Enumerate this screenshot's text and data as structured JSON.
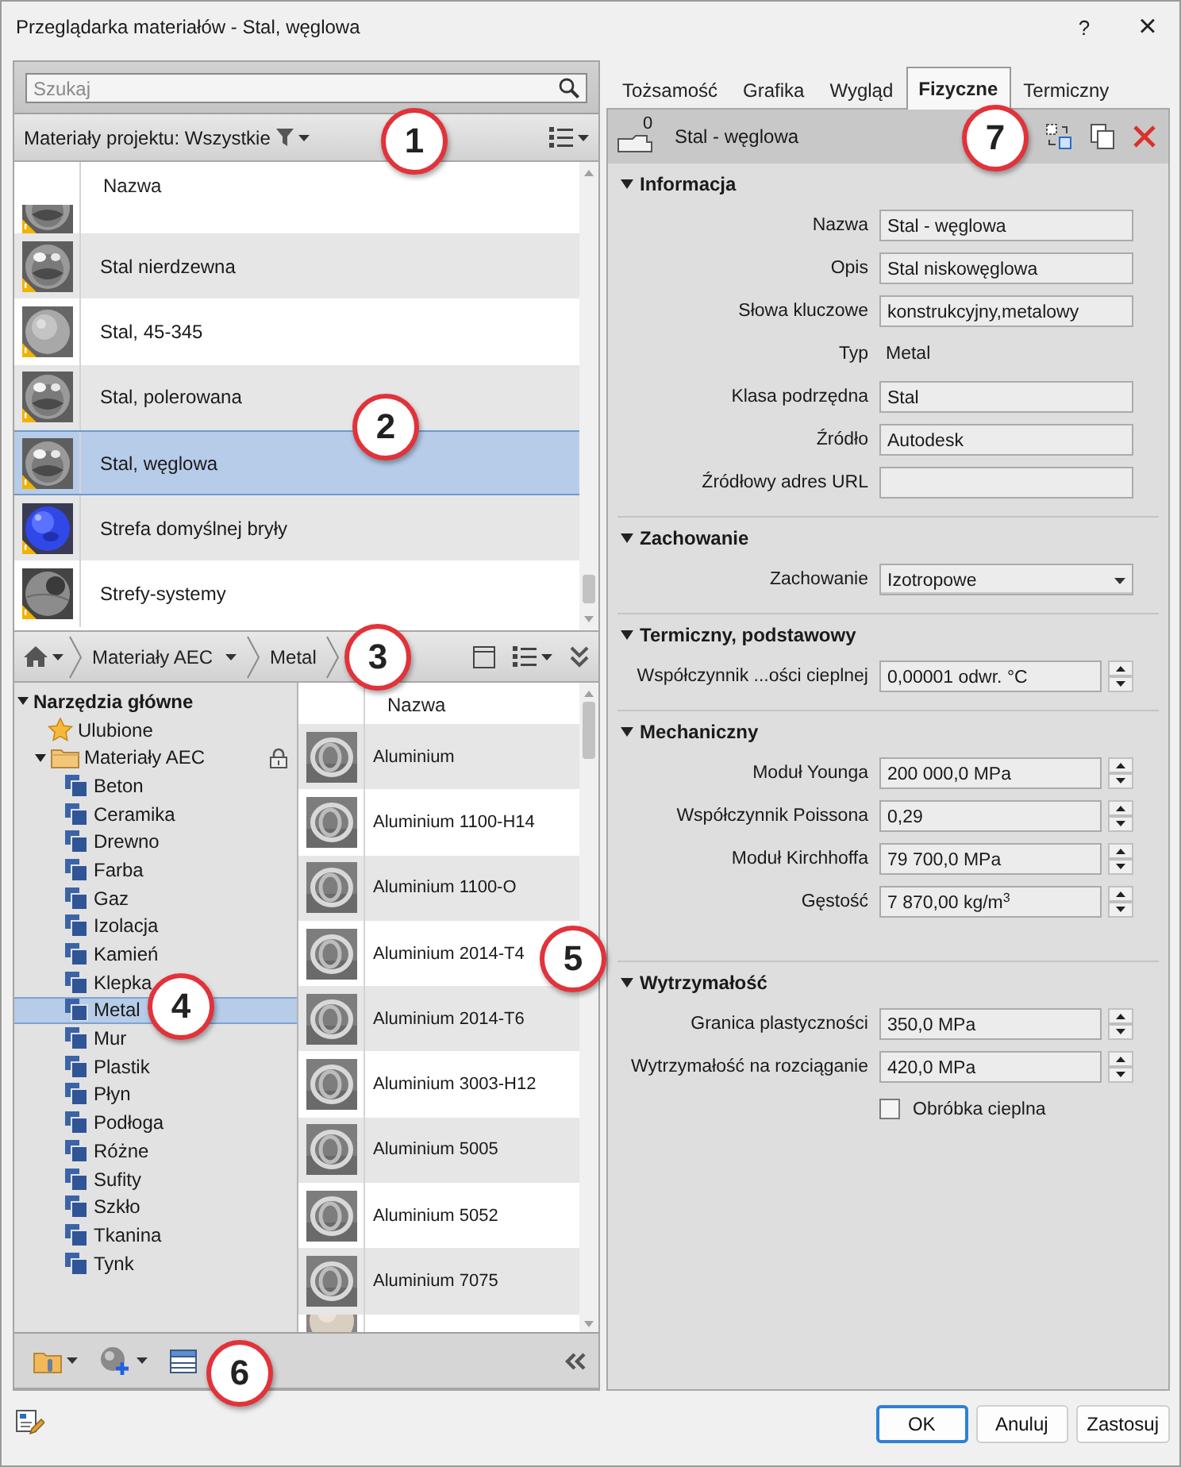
{
  "window": {
    "title": "Przeglądarka materiałów - Stal, węglowa",
    "help": "?",
    "close": "×"
  },
  "search": {
    "placeholder": "Szukaj"
  },
  "project_filter": {
    "label": "Materiały projektu: Wszystkie"
  },
  "project_materials": {
    "column": "Nazwa",
    "rows": [
      {
        "kind": "steel",
        "warning": true,
        "selected": false
      },
      {
        "name": "Stal nierdzewna",
        "kind": "steel",
        "warning": true,
        "selected": false
      },
      {
        "name": "Stal, 45-345",
        "kind": "matte",
        "warning": true,
        "selected": false
      },
      {
        "name": "Stal, polerowana",
        "kind": "steel",
        "warning": true,
        "selected": false
      },
      {
        "name": "Stal, węglowa",
        "kind": "steel",
        "warning": true,
        "selected": true
      },
      {
        "name": "Strefa domyślnej bryły",
        "kind": "blue",
        "warning": true,
        "selected": false
      },
      {
        "name": "Strefy-systemy",
        "kind": "dark",
        "warning": true,
        "selected": false
      }
    ]
  },
  "breadcrumb": [
    {
      "label": "Materiały AEC",
      "dropdown": true
    },
    {
      "label": "Metal",
      "dropdown": false
    }
  ],
  "tree": {
    "label": "Narzędzia główne",
    "expanded": true,
    "selected": false,
    "children": [
      {
        "label": "Ulubione",
        "kind": "favorites",
        "selected": false
      },
      {
        "label": "Materiały AEC",
        "kind": "folder",
        "expanded": true,
        "locked": true,
        "selected": false,
        "children": [
          {
            "label": "Beton",
            "kind": "category",
            "selected": false
          },
          {
            "label": "Ceramika",
            "kind": "category",
            "selected": false
          },
          {
            "label": "Drewno",
            "kind": "category",
            "selected": false
          },
          {
            "label": "Farba",
            "kind": "category",
            "selected": false
          },
          {
            "label": "Gaz",
            "kind": "category",
            "selected": false
          },
          {
            "label": "Izolacja",
            "kind": "category",
            "selected": false
          },
          {
            "label": "Kamień",
            "kind": "category",
            "selected": false
          },
          {
            "label": "Klepka",
            "kind": "category",
            "selected": false
          },
          {
            "label": "Metal",
            "kind": "category",
            "selected": true
          },
          {
            "label": "Mur",
            "kind": "category",
            "selected": false
          },
          {
            "label": "Plastik",
            "kind": "category",
            "selected": false
          },
          {
            "label": "Płyn",
            "kind": "category",
            "selected": false
          },
          {
            "label": "Podłoga",
            "kind": "category",
            "selected": false
          },
          {
            "label": "Różne",
            "kind": "category",
            "selected": false
          },
          {
            "label": "Sufity",
            "kind": "category",
            "selected": false
          },
          {
            "label": "Szkło",
            "kind": "category",
            "selected": false
          },
          {
            "label": "Tkanina",
            "kind": "category",
            "selected": false
          },
          {
            "label": "Tynk",
            "kind": "category",
            "selected": false
          }
        ]
      }
    ]
  },
  "library_materials": {
    "column": "Nazwa",
    "rows": [
      {
        "name": "Aluminium",
        "kind": "ring",
        "selected": false
      },
      {
        "name": "Aluminium 1100-H14",
        "kind": "ring",
        "selected": false
      },
      {
        "name": "Aluminium 1100-O",
        "kind": "ring",
        "selected": false
      },
      {
        "name": "Aluminium 2014-T4",
        "kind": "ring",
        "selected": false
      },
      {
        "name": "Aluminium 2014-T6",
        "kind": "ring",
        "selected": false
      },
      {
        "name": "Aluminium 3003-H12",
        "kind": "ring",
        "selected": false
      },
      {
        "name": "Aluminium 5005",
        "kind": "ring",
        "selected": false
      },
      {
        "name": "Aluminium 5052",
        "kind": "ring",
        "selected": false
      },
      {
        "name": "Aluminium 7075",
        "kind": "ring",
        "selected": false
      },
      {
        "kind": "beige",
        "selected": false
      }
    ]
  },
  "tabs": [
    {
      "label": "Tożsamość",
      "selected": false
    },
    {
      "label": "Grafika",
      "selected": false
    },
    {
      "label": "Wygląd",
      "selected": false
    },
    {
      "label": "Fizyczne",
      "selected": true
    },
    {
      "label": "Termiczny",
      "selected": false
    }
  ],
  "asset": {
    "count": "0",
    "name": "Stal - węglowa"
  },
  "sections": [
    {
      "title": "Informacja",
      "expanded": true,
      "properties": [
        {
          "label": "Nazwa",
          "kind": "text",
          "value": "Stal - węglowa"
        },
        {
          "label": "Opis",
          "kind": "text",
          "value": "Stal niskowęglowa"
        },
        {
          "label": "Słowa kluczowe",
          "kind": "text",
          "value": "konstrukcyjny,metalowy"
        },
        {
          "label": "Typ",
          "kind": "static",
          "value": "Metal"
        },
        {
          "label": "Klasa podrzędna",
          "kind": "text",
          "value": "Stal"
        },
        {
          "label": "Źródło",
          "kind": "text",
          "value": "Autodesk"
        },
        {
          "label": "Źródłowy adres URL",
          "kind": "text"
        }
      ]
    },
    {
      "title": "Zachowanie",
      "expanded": true,
      "properties": [
        {
          "label": "Zachowanie",
          "kind": "dropdown",
          "value": "Izotropowe"
        }
      ]
    },
    {
      "title": "Termiczny, podstawowy",
      "expanded": true,
      "properties": [
        {
          "label": "Współczynnik ...ości cieplnej",
          "kind": "spinner",
          "value": "0,00001 odwr. °C"
        }
      ]
    },
    {
      "title": "Mechaniczny",
      "expanded": true,
      "properties": [
        {
          "label": "Moduł Younga",
          "kind": "spinner",
          "value": "200 000,0 MPa"
        },
        {
          "label": "Współczynnik Poissona",
          "kind": "spinner",
          "value": "0,29"
        },
        {
          "label": "Moduł Kirchhoffa",
          "kind": "spinner",
          "value": "79 700,0 MPa"
        },
        {
          "label": "Gęstość",
          "kind": "spinner",
          "value": "7 870,00 kg/m$^{3}$"
        }
      ]
    },
    {
      "title": "Wytrzymałość",
      "expanded": true,
      "properties": [
        {
          "label": "Granica plastyczności",
          "kind": "spinner",
          "value": "350,0 MPa"
        },
        {
          "label": "Wytrzymałość na rozciąganie",
          "kind": "spinner",
          "value": "420,0 MPa"
        },
        {
          "label": "Obróbka cieplna",
          "kind": "checkbox",
          "checked": false
        }
      ]
    }
  ],
  "buttons": [
    {
      "label": "OK",
      "default": true
    },
    {
      "label": "Anuluj",
      "default": false
    },
    {
      "label": "Zastosuj",
      "default": false
    }
  ],
  "callouts": [
    "1",
    "2",
    "3",
    "4",
    "5",
    "6",
    "7"
  ]
}
